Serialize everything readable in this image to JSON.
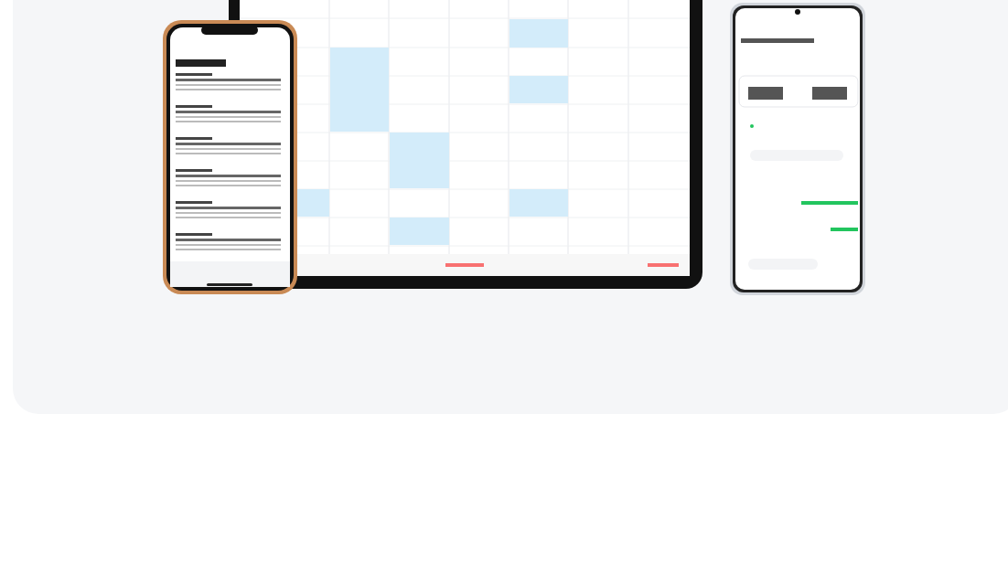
{
  "hero": {
    "image": {
      "kind": "devices"
    }
  }
}
